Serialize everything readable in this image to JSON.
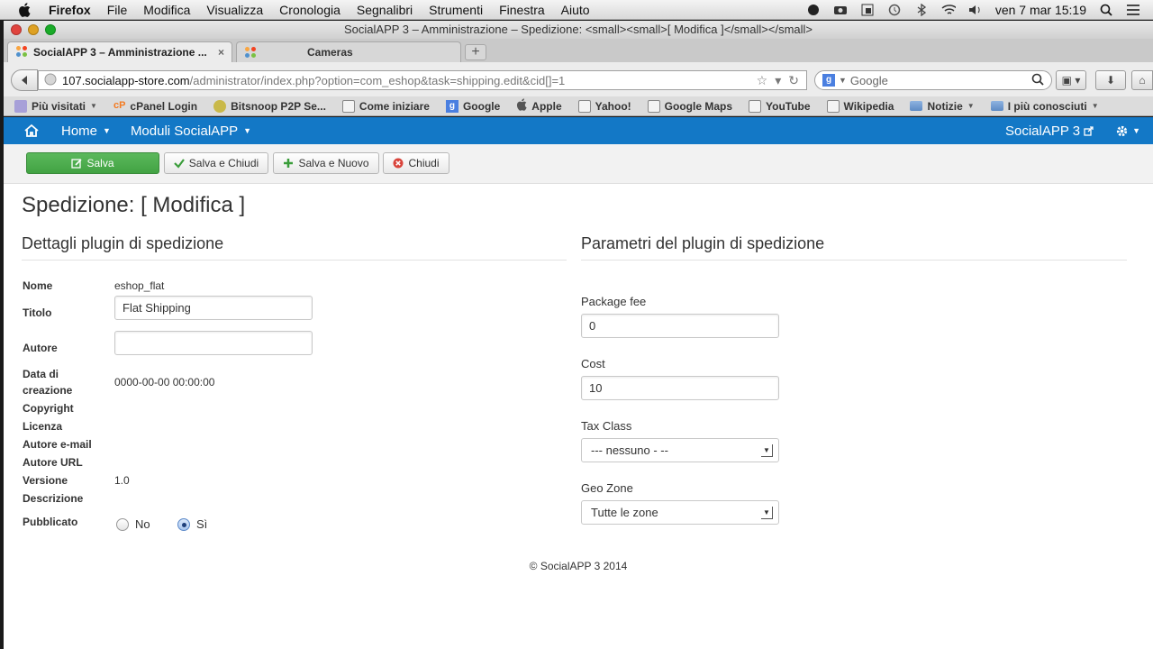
{
  "menubar": {
    "app": "Firefox",
    "items": [
      "File",
      "Modifica",
      "Visualizza",
      "Cronologia",
      "Segnalibri",
      "Strumenti",
      "Finestra",
      "Aiuto"
    ],
    "clock": "ven 7 mar  15:19"
  },
  "window": {
    "title": "SocialAPP 3 – Amministrazione – Spedizione: <small><small>[ Modifica ]</small></small>"
  },
  "tabs": [
    {
      "label": "SocialAPP 3 – Amministrazione ...",
      "close": "×"
    },
    {
      "label": "Cameras"
    }
  ],
  "newtab_label": "+",
  "nav": {
    "url_host": "107.socialapp-store.com",
    "url_path": "/administrator/index.php?option=com_eshop&task=shipping.edit&cid[]=1",
    "search_placeholder": "Google"
  },
  "bookmarks": [
    {
      "label": "Più visitati",
      "icon": "star",
      "arrow": "▼"
    },
    {
      "label": "cPanel Login",
      "icon": "cp"
    },
    {
      "label": "Bitsnoop P2P Se...",
      "icon": "bitsnoop"
    },
    {
      "label": "Come iniziare",
      "icon": "page"
    },
    {
      "label": "Google",
      "icon": "goog"
    },
    {
      "label": "Apple",
      "icon": "apple"
    },
    {
      "label": "Yahoo!",
      "icon": "page"
    },
    {
      "label": "Google Maps",
      "icon": "page"
    },
    {
      "label": "YouTube",
      "icon": "page"
    },
    {
      "label": "Wikipedia",
      "icon": "page"
    },
    {
      "label": "Notizie",
      "icon": "folder",
      "arrow": "▼"
    },
    {
      "label": "I più conosciuti",
      "icon": "folder",
      "arrow": "▼"
    }
  ],
  "admin_nav": {
    "home": "Home",
    "modules": "Moduli SocialAPP",
    "brand": "SocialAPP 3"
  },
  "toolbar": {
    "save": "Salva",
    "save_close": "Salva e Chiudi",
    "save_new": "Salva e Nuovo",
    "close": "Chiudi"
  },
  "page": {
    "title": "Spedizione: [ Modifica ]",
    "details_heading": "Dettagli plugin di spedizione",
    "params_heading": "Parametri del plugin di spedizione",
    "footer": "© SocialAPP 3 2014"
  },
  "details": {
    "name_label": "Nome",
    "name_value": "eshop_flat",
    "title_label": "Titolo",
    "title_value": "Flat Shipping",
    "author_label": "Autore",
    "author_value": "",
    "created_label_1": "Data di",
    "created_label_2": "creazione",
    "created_value": "0000-00-00 00:00:00",
    "copyright_label": "Copyright",
    "license_label": "Licenza",
    "author_email_label": "Autore e-mail",
    "author_url_label": "Autore URL",
    "version_label": "Versione",
    "version_value": "1.0",
    "description_label": "Descrizione",
    "published_label": "Pubblicato",
    "published_no": "No",
    "published_yes": "Sì",
    "published_selected": "Sì"
  },
  "params": {
    "package_fee_label": "Package fee",
    "package_fee_value": "0",
    "cost_label": "Cost",
    "cost_value": "10",
    "tax_class_label": "Tax Class",
    "tax_class_value": "--- nessuno - --",
    "geo_zone_label": "Geo Zone",
    "geo_zone_value": "Tutte le zone"
  },
  "colors": {
    "admin_nav": "#1378c6",
    "save_button": "#4cae4c"
  }
}
